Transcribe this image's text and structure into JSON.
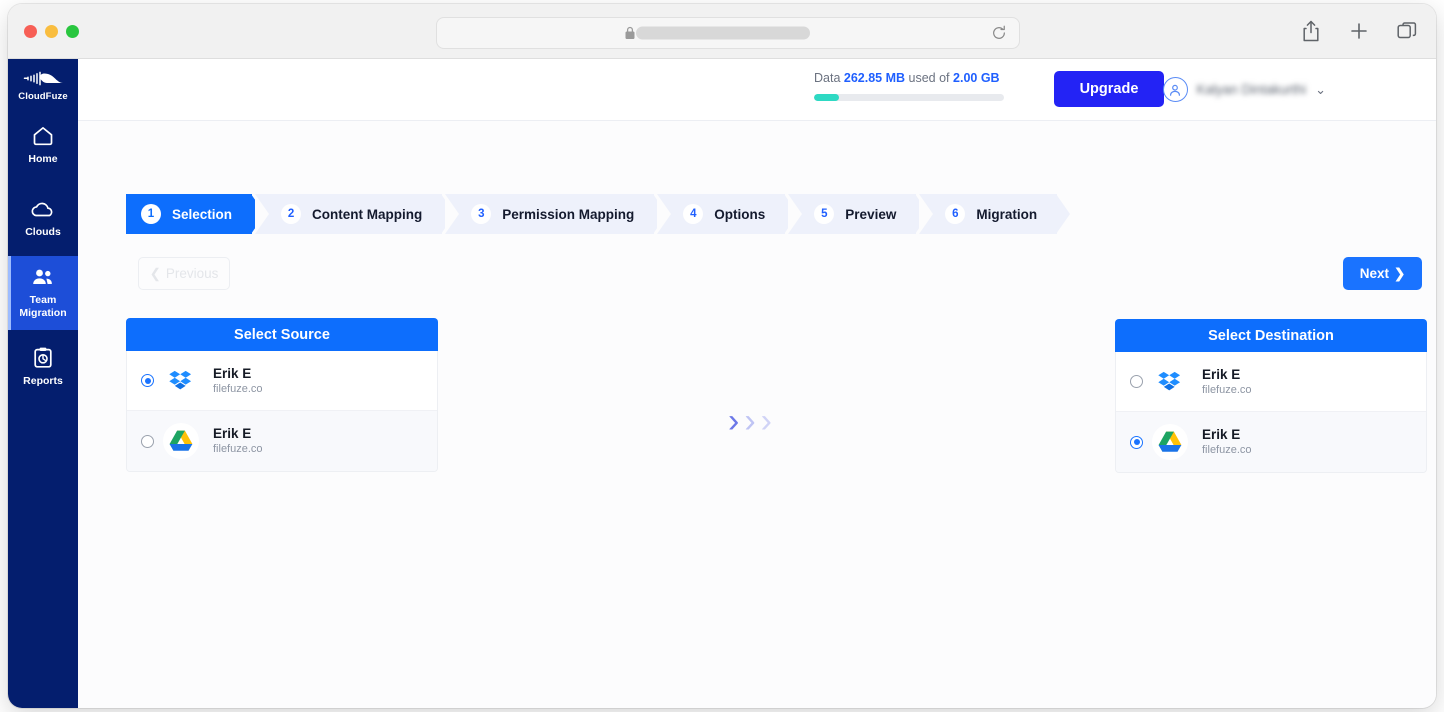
{
  "browser": {
    "traffic_lights": [
      "close",
      "minimize",
      "maximize"
    ],
    "url_value": "",
    "url_redacted": true,
    "icons": {
      "lock": "lock-icon",
      "reload": "reload-icon",
      "share": "share-icon",
      "new_tab": "plus-icon",
      "tabs": "tabs-icon"
    }
  },
  "sidebar": {
    "brand": "CloudFuze",
    "items": [
      {
        "label": "Home",
        "icon": "home-icon",
        "active": false
      },
      {
        "label": "Clouds",
        "icon": "cloud-icon",
        "active": false
      },
      {
        "label": "Team Migration",
        "icon": "users-icon",
        "active": true
      },
      {
        "label": "Reports",
        "icon": "clipboard-chart-icon",
        "active": false
      }
    ]
  },
  "topbar": {
    "usage_prefix": "Data",
    "usage_used": "262.85 MB",
    "usage_middle": "used of",
    "usage_total": "2.00 GB",
    "usage_percent": 13,
    "upgrade_label": "Upgrade",
    "account_name": "Kalyan Dintakurthi",
    "account_chevron": "⌄",
    "accent_blue": "#1f5fff",
    "usage_bar_color": "#2ed9c3",
    "upgrade_color": "#2323f5"
  },
  "stepper": {
    "steps": [
      {
        "num": "1",
        "label": "Selection",
        "active": true
      },
      {
        "num": "2",
        "label": "Content Mapping",
        "active": false
      },
      {
        "num": "3",
        "label": "Permission Mapping",
        "active": false
      },
      {
        "num": "4",
        "label": "Options",
        "active": false
      },
      {
        "num": "5",
        "label": "Preview",
        "active": false
      },
      {
        "num": "6",
        "label": "Migration",
        "active": false
      }
    ]
  },
  "nav_buttons": {
    "previous_label": "Previous",
    "previous_icon": "❮",
    "previous_disabled": true,
    "next_label": "Next",
    "next_icon": "❯"
  },
  "source_panel": {
    "title": "Select Source",
    "accounts": [
      {
        "name": "Erik E",
        "domain": "filefuze.co",
        "provider": "dropbox",
        "selected": true
      },
      {
        "name": "Erik E",
        "domain": "filefuze.co",
        "provider": "google-drive",
        "selected": false
      }
    ]
  },
  "destination_panel": {
    "title": "Select Destination",
    "accounts": [
      {
        "name": "Erik E",
        "domain": "filefuze.co",
        "provider": "dropbox",
        "selected": false
      },
      {
        "name": "Erik E",
        "domain": "filefuze.co",
        "provider": "google-drive",
        "selected": true
      }
    ]
  },
  "transfer_arrows": {
    "glyph": "›",
    "count": 3,
    "color": "#6c78e8"
  }
}
